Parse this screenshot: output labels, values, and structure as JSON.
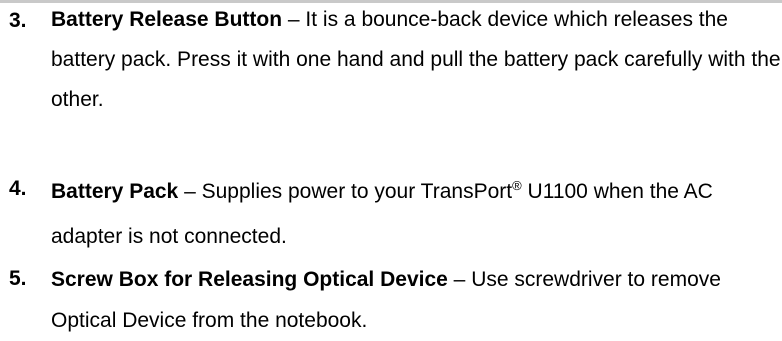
{
  "items": [
    {
      "number": "3.",
      "term": "Battery Release Button",
      "dash": " – ",
      "text": "It is a bounce-back device which releases the battery pack. Press it with one hand and pull the battery pack carefully with the other."
    },
    {
      "number": "4.",
      "term": "Battery Pack",
      "dash": " – ",
      "text_before": "Supplies power to your TransPort",
      "superscript": "®",
      "text_after": " U1100 when the AC adapter is not connected."
    },
    {
      "number": "5.",
      "term": "Screw Box for Releasing Optical Device",
      "dash": " – ",
      "text": "Use screwdriver to remove Optical Device from the notebook."
    }
  ]
}
